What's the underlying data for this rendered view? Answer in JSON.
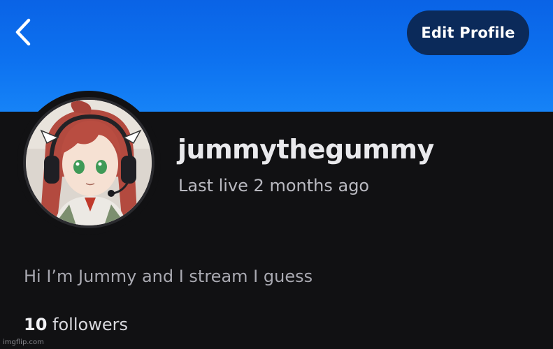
{
  "header": {
    "back_icon": "chevron-left-icon",
    "edit_profile_label": "Edit Profile"
  },
  "profile": {
    "username": "jummythegummy",
    "last_live": "Last live 2 months ago",
    "bio": "Hi I’m Jummy and I stream I guess",
    "followers_count": "10",
    "followers_label": "followers",
    "avatar_description": "anime-character-avatar-with-headset"
  },
  "colors": {
    "banner": "#0d72f0",
    "background": "#111113",
    "edit_button_bg": "#0b2a5a",
    "username_text": "#e9e9ec",
    "secondary_text": "#b9b9c0"
  },
  "watermark": "imgflip.com"
}
